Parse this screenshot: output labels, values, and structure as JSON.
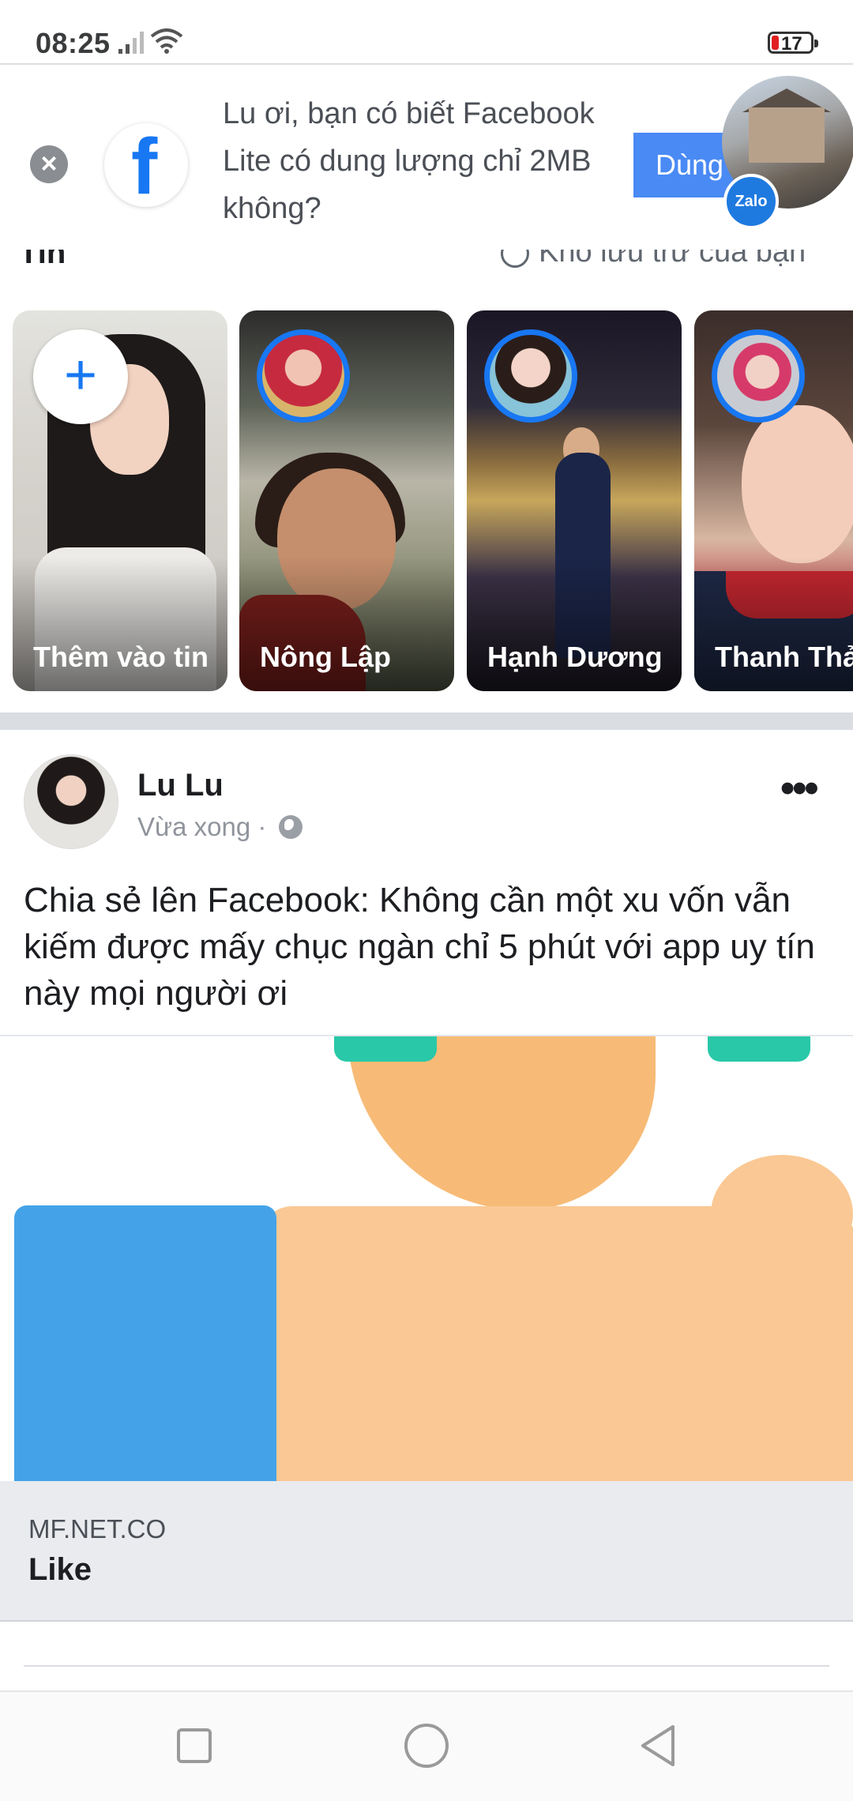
{
  "status_bar": {
    "time": "08:25",
    "battery": "17",
    "battery_color": "#e02020"
  },
  "banner": {
    "message": "Lu ơi, bạn có biết Facebook Lite có dung lượng chỉ 2MB không?",
    "use_button": "Dùng",
    "badge": "Zalo",
    "icon": "facebook-logo-icon",
    "brand_color": "#1877f2"
  },
  "stories": {
    "title": "Tin",
    "archive_label": "Kho lưu trữ của bạn",
    "items": [
      {
        "name": "Thêm vào tin"
      },
      {
        "name": "Nông Lập"
      },
      {
        "name": "Hạnh Dương"
      },
      {
        "name": "Thanh Thảo"
      }
    ]
  },
  "post": {
    "author": "Lu Lu",
    "time": "Vừa xong ·",
    "privacy_icon": "globe-icon",
    "text": "Chia sẻ lên Facebook: Không cần một xu vốn vẫn kiếm được mấy chục ngàn chỉ 5 phút với app uy tín này mọi người ơi",
    "link": {
      "domain": "MF.NET.CO",
      "title": "Like"
    }
  }
}
